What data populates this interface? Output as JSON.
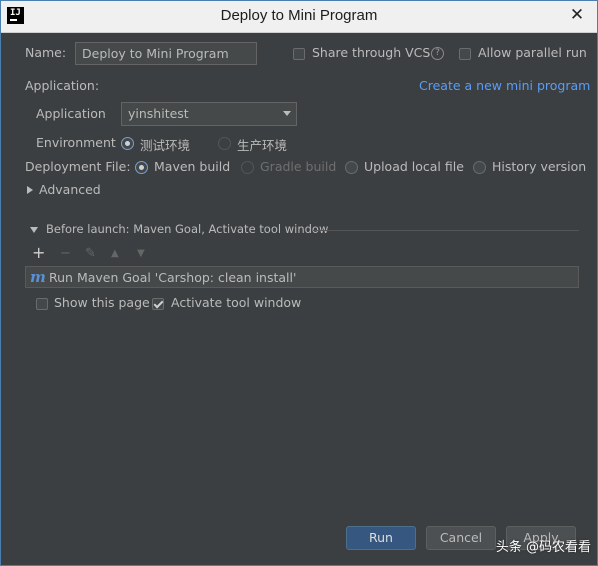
{
  "window": {
    "title": "Deploy to Mini Program",
    "app_icon_text": "IJ"
  },
  "form": {
    "name_label": "Name:",
    "name_value": "Deploy to Mini Program",
    "share_vcs_label": "Share through VCS",
    "share_vcs_checked": false,
    "allow_parallel_label": "Allow parallel run",
    "allow_parallel_checked": false,
    "application_section_label": "Application:",
    "create_link": "Create a new mini program",
    "application_label": "Application",
    "application_value": "yinshitest",
    "environment_label": "Environment",
    "environment_options": [
      {
        "label": "测试环境",
        "selected": true
      },
      {
        "label": "生产环境",
        "selected": false
      }
    ],
    "deployment_label": "Deployment File:",
    "deployment_options": [
      {
        "label": "Maven build",
        "selected": true,
        "enabled": true
      },
      {
        "label": "Gradle build",
        "selected": false,
        "enabled": false
      },
      {
        "label": "Upload local file",
        "selected": false,
        "enabled": true
      },
      {
        "label": "History version",
        "selected": false,
        "enabled": true
      }
    ],
    "advanced_label": "Advanced"
  },
  "before_launch": {
    "header": "Before launch: Maven Goal, Activate tool window",
    "tools": [
      "add-icon",
      "remove-icon",
      "edit-icon",
      "move-up-icon",
      "move-down-icon"
    ],
    "tool_glyphs": [
      "+",
      "−",
      "✎",
      "▲",
      "▼"
    ],
    "items": [
      {
        "icon": "m",
        "text": "Run Maven Goal 'Carshop: clean install'"
      }
    ],
    "show_page_label": "Show this page",
    "show_page_checked": false,
    "activate_label": "Activate tool window",
    "activate_checked": true
  },
  "buttons": {
    "run": "Run",
    "cancel": "Cancel",
    "apply": "Apply"
  },
  "watermark": "头条 @码农看看",
  "colors": {
    "background": "#3c3f41",
    "link": "#589df6",
    "primary_button": "#365880",
    "title_bar": "#f0f0f0"
  }
}
